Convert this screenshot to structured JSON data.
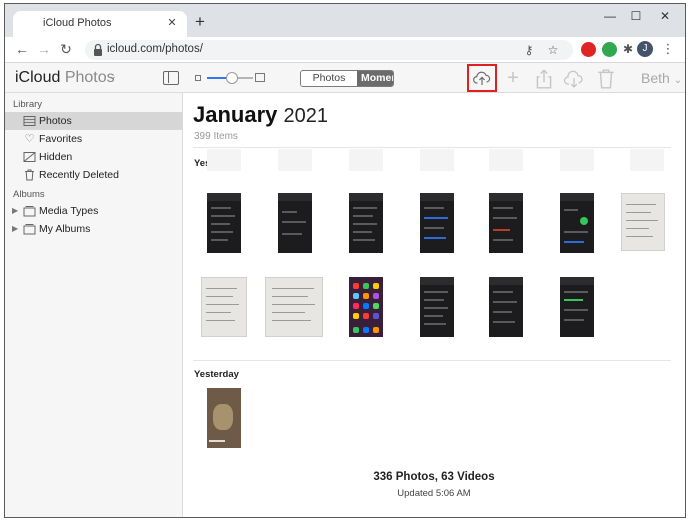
{
  "browser": {
    "tab_title": "iCloud Photos",
    "tab_close": "✕",
    "new_tab": "+",
    "url": "icloud.com/photos/",
    "profile_initial": "J"
  },
  "app": {
    "title_main": "iCloud",
    "title_sub": "Photos",
    "view_tabs": [
      "Photos",
      "Moments"
    ],
    "user": "Beth",
    "zoom_level": 0.55,
    "accent_color": "#3478f6",
    "highlight_color": "#e02020"
  },
  "sidebar": {
    "library_header": "Library",
    "library_items": [
      {
        "label": "Photos",
        "icon": "photos-icon",
        "selected": true
      },
      {
        "label": "Favorites",
        "icon": "heart-icon",
        "selected": false
      },
      {
        "label": "Hidden",
        "icon": "hidden-icon",
        "selected": false
      },
      {
        "label": "Recently Deleted",
        "icon": "trash-icon",
        "selected": false
      }
    ],
    "albums_header": "Albums",
    "album_items": [
      {
        "label": "Media Types",
        "icon": "album-icon"
      },
      {
        "label": "My Albums",
        "icon": "album-icon"
      }
    ]
  },
  "main": {
    "month": "January",
    "year": "2021",
    "item_count": "399 Items",
    "section1_label": "Yesterday",
    "section2_label": "Yesterday",
    "summary": "336 Photos, 63 Videos",
    "updated": "Updated 5:06 AM"
  }
}
